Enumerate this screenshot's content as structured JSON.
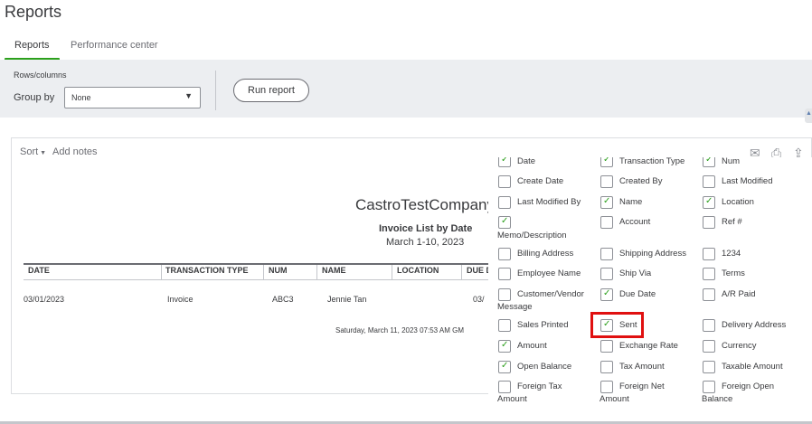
{
  "page": {
    "title": "Reports"
  },
  "tabs": [
    {
      "label": "Reports",
      "active": true
    },
    {
      "label": "Performance center",
      "active": false
    }
  ],
  "settings": {
    "rows_columns_label": "Rows/columns",
    "group_by_label": "Group by",
    "group_by_value": "None",
    "run_report_label": "Run report"
  },
  "report": {
    "sort_label": "Sort",
    "notes_label": "Add notes",
    "company": "CastroTestCompany",
    "title": "Invoice List by Date",
    "date_range": "March 1-10, 2023",
    "columns": [
      "DATE",
      "TRANSACTION TYPE",
      "NUM",
      "NAME",
      "LOCATION",
      "DUE D"
    ],
    "rows": [
      [
        "03/01/2023",
        "Invoice",
        "ABC3",
        "Jennie Tan",
        "",
        "03/"
      ]
    ],
    "footer_timestamp": "Saturday, March 11, 2023   07:53 AM GM"
  },
  "column_options": [
    {
      "label": "Date",
      "checked": true
    },
    {
      "label": "Transaction Type",
      "checked": true
    },
    {
      "label": "Num",
      "checked": true
    },
    {
      "label": "Create Date",
      "checked": false
    },
    {
      "label": "Created By",
      "checked": false
    },
    {
      "label": "Last Modified",
      "checked": false
    },
    {
      "label": "Last Modified By",
      "checked": false
    },
    {
      "label": "Name",
      "checked": true
    },
    {
      "label": "Location",
      "checked": true
    },
    {
      "label": "Memo/Description",
      "checked": true
    },
    {
      "label": "Account",
      "checked": false
    },
    {
      "label": "Ref #",
      "checked": false
    },
    {
      "label": "Billing Address",
      "checked": false
    },
    {
      "label": "Shipping Address",
      "checked": false
    },
    {
      "label": "1234",
      "checked": false
    },
    {
      "label": "Employee Name",
      "checked": false
    },
    {
      "label": "Ship Via",
      "checked": false
    },
    {
      "label": "Terms",
      "checked": false
    },
    {
      "label": "Customer/Vendor Message",
      "checked": false
    },
    {
      "label": "Due Date",
      "checked": true
    },
    {
      "label": "A/R Paid",
      "checked": false
    },
    {
      "label": "Sales Printed",
      "checked": false
    },
    {
      "label": "Sent",
      "checked": true,
      "highlighted": true
    },
    {
      "label": "Delivery Address",
      "checked": false
    },
    {
      "label": "Amount",
      "checked": true
    },
    {
      "label": "Exchange Rate",
      "checked": false
    },
    {
      "label": "Currency",
      "checked": false
    },
    {
      "label": "Open Balance",
      "checked": true
    },
    {
      "label": "Tax Amount",
      "checked": false
    },
    {
      "label": "Taxable Amount",
      "checked": false
    },
    {
      "label": "Foreign Tax Amount",
      "checked": false
    },
    {
      "label": "Foreign Net Amount",
      "checked": false
    },
    {
      "label": "Foreign Open Balance",
      "checked": false
    }
  ],
  "colors": {
    "accent": "#2ca01c",
    "highlight": "#e01010"
  },
  "icons": [
    "caret-down-icon",
    "email-icon",
    "print-icon",
    "export-icon"
  ]
}
